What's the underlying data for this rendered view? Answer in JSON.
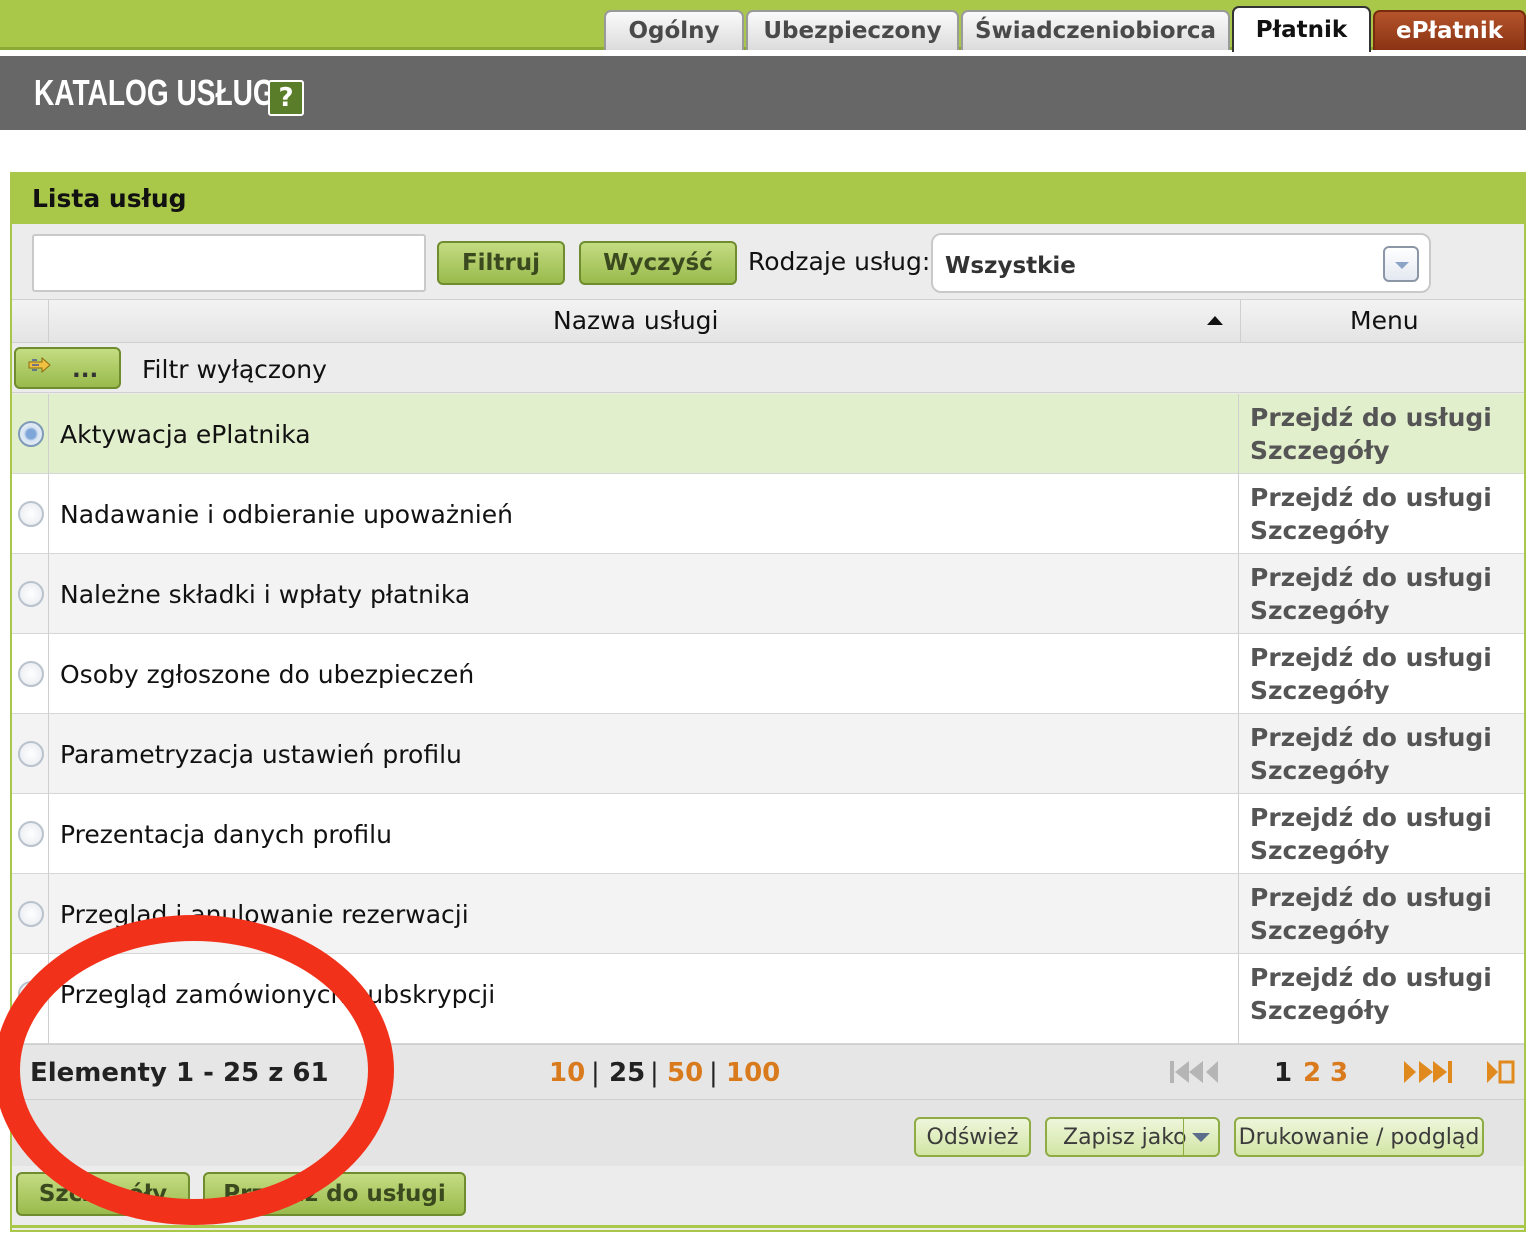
{
  "tabs": [
    {
      "label": "Ogólny"
    },
    {
      "label": "Ubezpieczony"
    },
    {
      "label": "Świadczeniobiorca"
    },
    {
      "label": "Płatnik"
    },
    {
      "label": "ePłatnik"
    }
  ],
  "header": {
    "title": "KATALOG USŁUG",
    "help_label": "?"
  },
  "panel": {
    "title": "Lista usług"
  },
  "filter": {
    "input_value": "",
    "filter_button": "Filtruj",
    "clear_button": "Wyczyść",
    "type_label": "Rodzaje usług:",
    "type_selected": "Wszystkie"
  },
  "table": {
    "col_name": "Nazwa usługi",
    "col_menu": "Menu",
    "filter_button_label": "...",
    "filter_status": "Filtr wyłączony",
    "rows": [
      {
        "name": "Aktywacja ePlatnika",
        "link1": "Przejdź do usługi",
        "link2": "Szczegóły"
      },
      {
        "name": "Nadawanie i odbieranie upoważnień",
        "link1": "Przejdź do usługi",
        "link2": "Szczegóły"
      },
      {
        "name": "Należne składki i wpłaty płatnika",
        "link1": "Przejdź do usługi",
        "link2": "Szczegóły"
      },
      {
        "name": "Osoby zgłoszone do ubezpieczeń",
        "link1": "Przejdź do usługi",
        "link2": "Szczegóły"
      },
      {
        "name": "Parametryzacja ustawień profilu",
        "link1": "Przejdź do usługi",
        "link2": "Szczegóły"
      },
      {
        "name": "Prezentacja danych profilu",
        "link1": "Przejdź do usługi",
        "link2": "Szczegóły"
      },
      {
        "name": "Przegląd i anulowanie rezerwacji",
        "link1": "Przejdź do usługi",
        "link2": "Szczegóły"
      },
      {
        "name": "Przegląd zamówionych subskrypcji",
        "link1": "Przejdź do usługi",
        "link2": "Szczegóły"
      }
    ]
  },
  "pager": {
    "info": "Elementy 1 - 25 z 61",
    "sizes": [
      "10",
      "25",
      "50",
      "100"
    ],
    "pages": [
      "1",
      "2",
      "3"
    ]
  },
  "actions": {
    "refresh": "Odśwież",
    "save_as": "Zapisz jako",
    "print": "Drukowanie / podgląd"
  },
  "bottom": {
    "details": "Szczegóły",
    "goto": "Przejdź do usługi"
  },
  "colors": {
    "brand_green": "#a9c84a",
    "header_grey": "#676767",
    "eplatnik_tab": "#a0441f",
    "pager_orange": "#d97a1c",
    "annotation_red": "#f2311b"
  }
}
